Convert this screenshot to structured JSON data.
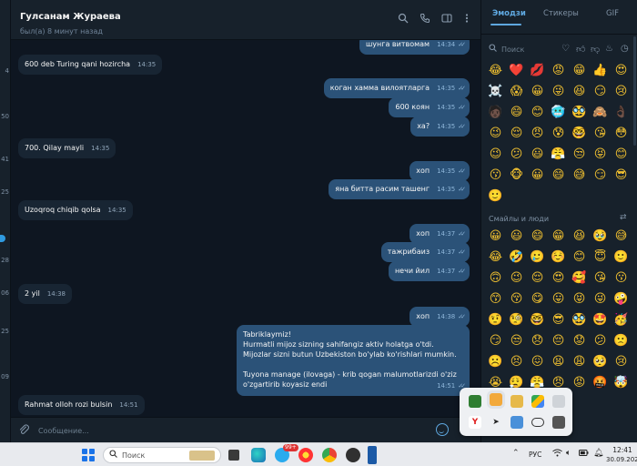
{
  "chat": {
    "name": "Гулсанам Жураева",
    "status": "был(а) 8 минут назад"
  },
  "header_icons": [
    "search-icon",
    "phone-icon",
    "sidebar-icon",
    "more-icon"
  ],
  "left_strip": [
    "4",
    "50",
    "41",
    "25",
    "28",
    "06",
    "25",
    "09"
  ],
  "messages": [
    {
      "dir": "out",
      "text": "шунга витвомам",
      "time": "14:34",
      "read": true
    },
    {
      "dir": "in",
      "text": "600 deb Turing qani hozircha",
      "time": "14:35"
    },
    {
      "dir": "out",
      "text": "коган хамма вилоятларга",
      "time": "14:35",
      "read": true
    },
    {
      "dir": "out",
      "text": "600 коян",
      "time": "14:35",
      "read": true
    },
    {
      "dir": "out",
      "text": "ха?",
      "time": "14:35",
      "read": true
    },
    {
      "dir": "in",
      "text": "700. Qilay mayli",
      "time": "14:35"
    },
    {
      "dir": "out",
      "text": "хоп",
      "time": "14:35",
      "read": true
    },
    {
      "dir": "out",
      "text": "яна битта расим ташенг",
      "time": "14:35",
      "read": true
    },
    {
      "dir": "in",
      "text": "Uzoqroq chiqib qolsa",
      "time": "14:35"
    },
    {
      "dir": "out",
      "text": "хоп",
      "time": "14:37",
      "read": true
    },
    {
      "dir": "out",
      "text": "тажрибаиз",
      "time": "14:37",
      "read": true
    },
    {
      "dir": "out",
      "text": "нечи йил",
      "time": "14:37",
      "read": true
    },
    {
      "dir": "in",
      "text": "2 yil",
      "time": "14:38"
    },
    {
      "dir": "out",
      "text": "хоп",
      "time": "14:38",
      "read": true
    },
    {
      "dir": "out",
      "lines": [
        "Tabriklaymiz!",
        "Hurmatli mijoz sizning sahifangiz aktiv holatga o'tdi.",
        "Mijozlar sizni butun Uzbekiston bo'ylab ko'rishlari mumkin.",
        "",
        "Tuyona manage (ilovaga) - krib qogan malumotlarizdi o'ziz",
        "o'zgartirib koyasiz endi"
      ],
      "time": "14:51",
      "read": true
    },
    {
      "dir": "in",
      "text": "Rahmat olloh rozi bulsin",
      "time": "14:51"
    }
  ],
  "composer": {
    "placeholder": "Сообщение..."
  },
  "emoji_panel": {
    "tabs": [
      "Эмодзи",
      "Стикеры",
      "GIF"
    ],
    "active_tab": "Эмодзи",
    "search_placeholder": "Поиск",
    "category_icons": [
      "heart-icon",
      "thumbs-up-icon",
      "thumbs-down-icon",
      "fire-icon",
      "clock-icon",
      "smile-icon"
    ],
    "recent": [
      "😂",
      "❤️",
      "💋",
      "😡",
      "😁",
      "👍",
      "😍",
      "☠️",
      "😱",
      "😀",
      "😜",
      "😆",
      "😏",
      "😢",
      "🧑🏿",
      "😄",
      "😊",
      "🥶",
      "🥸",
      "🙈",
      "👌🏿",
      "😉",
      "😌",
      "😠",
      "😰",
      "🤓",
      "😘",
      "😳",
      "😉",
      "😕",
      "😃",
      "😤",
      "😒",
      "😝",
      "😊",
      "😗",
      "🐵",
      "😀",
      "😄",
      "😅",
      "😏",
      "😎",
      "🙂"
    ],
    "section_title": "Смайлы и люди",
    "smileys": [
      "😀",
      "😃",
      "😄",
      "😁",
      "😆",
      "🥹",
      "😅",
      "😂",
      "🤣",
      "🥲",
      "☺️",
      "😊",
      "😇",
      "🙂",
      "🙃",
      "😉",
      "😌",
      "😍",
      "🥰",
      "😘",
      "😗",
      "😙",
      "😚",
      "😋",
      "😛",
      "😝",
      "😜",
      "🤪",
      "🤨",
      "🧐",
      "🤓",
      "😎",
      "🥸",
      "🤩",
      "🥳",
      "😏",
      "😒",
      "😞",
      "😔",
      "😟",
      "😕",
      "🙁",
      "☹️",
      "😣",
      "😖",
      "😫",
      "😩",
      "🥺",
      "😢",
      "😭",
      "😮‍💨",
      "😤",
      "😠",
      "😡",
      "🤬",
      "🤯",
      "😳"
    ]
  },
  "tray_popup": {
    "icons": [
      "nvidia-icon",
      "folder-icon",
      "stack-icon",
      "drive-icon",
      "usb-icon",
      "yandex-icon",
      "telegram-icon",
      "mail-icon",
      "gamepad-icon",
      "app-icon"
    ]
  },
  "taskbar": {
    "search_placeholder": "Поиск",
    "apps": [
      "files-icon",
      "edge-icon",
      "telegram-taskbar-icon",
      "yandex-browser-icon",
      "chrome-icon",
      "obs-icon",
      "notepad-icon"
    ],
    "badge": "99+",
    "lang": "РУС",
    "time": "12:41",
    "date": "30.09.2025"
  }
}
